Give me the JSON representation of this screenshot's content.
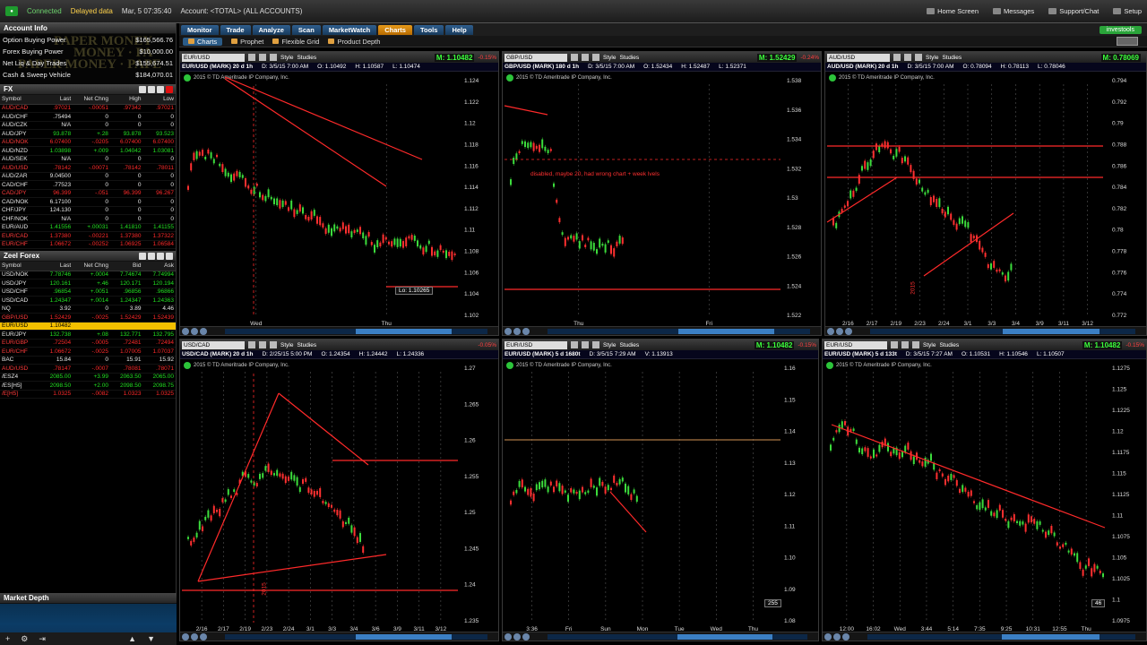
{
  "topbar": {
    "status": "Connected",
    "delay": "Delayed data",
    "datetime": "Mar, 5 07:35:40",
    "account": "Account: <TOTAL> (ALL ACCOUNTS)",
    "links": [
      "Home Screen",
      "Messages",
      "Support/Chat",
      "Setup"
    ]
  },
  "account_info": {
    "title": "Account Info",
    "watermark": [
      "PAPER MONEY",
      "MONEY · PA",
      "PAPER MONEY · PAPE"
    ],
    "rows": [
      {
        "label": "Option Buying Power",
        "value": "$165,566.76"
      },
      {
        "label": "Forex Buying Power",
        "value": "$10,000.00"
      },
      {
        "label": "Net Liq & Day Trades",
        "value": "$155,674.51"
      },
      {
        "label": "Cash & Sweep Vehicle",
        "value": "$184,070.01"
      }
    ]
  },
  "fx_panel": {
    "title": "FX",
    "headers": [
      "Symbol",
      "Last",
      "Net Chng",
      "High",
      "Low"
    ],
    "rows": [
      [
        "AUD/CAD",
        ".97021",
        "-.00051",
        ".97342",
        ".97021",
        "dn"
      ],
      [
        "AUD/CHF",
        ".75494",
        "0",
        "0",
        "0",
        "neu"
      ],
      [
        "AUD/CZK",
        "N/A",
        "0",
        "0",
        "0",
        "neu"
      ],
      [
        "AUD/JPY",
        "93.878",
        "+.28",
        "93.878",
        "93.523",
        "up"
      ],
      [
        "AUD/NOK",
        "6.07400",
        "-.0205",
        "6.07400",
        "6.07400",
        "dn"
      ],
      [
        "AUD/NZD",
        "1.03898",
        "+.009",
        "1.04042",
        "1.03081",
        "up"
      ],
      [
        "AUD/SEK",
        "N/A",
        "0",
        "0",
        "0",
        "neu"
      ],
      [
        "AUD/USD",
        ".78142",
        "-.00071",
        ".78142",
        ".78011",
        "dn"
      ],
      [
        "AUD/ZAR",
        "9.04500",
        "0",
        "0",
        "0",
        "neu"
      ],
      [
        "CAD/CHF",
        ".77523",
        "0",
        "0",
        "0",
        "neu"
      ],
      [
        "CAD/JPY",
        "96.399",
        "-.051",
        "96.399",
        "96.267",
        "dn"
      ],
      [
        "CAD/NOK",
        "6.17100",
        "0",
        "0",
        "0",
        "neu"
      ],
      [
        "CHF/JPY",
        "124.130",
        "0",
        "0",
        "0",
        "neu"
      ],
      [
        "CHF/NOK",
        "N/A",
        "0",
        "0",
        "0",
        "neu"
      ],
      [
        "EUR/AUD",
        "1.41556",
        "+.00031",
        "1.41810",
        "1.41155",
        "up"
      ],
      [
        "EUR/CAD",
        "1.37380",
        "-.00221",
        "1.37380",
        "1.37322",
        "dn"
      ],
      [
        "EUR/CHF",
        "1.06672",
        "-.00252",
        "1.06925",
        "1.06584",
        "dn"
      ]
    ]
  },
  "zeel_panel": {
    "title": "Zeel Forex",
    "headers": [
      "Symbol",
      "Last",
      "Net Chng",
      "Bid",
      "Ask"
    ],
    "rows": [
      [
        "USD/NOK",
        "7.78746",
        "+.0004",
        "7.74674",
        "7.74994",
        "up",
        ""
      ],
      [
        "USD/JPY",
        "120.161",
        "+.46",
        "120.171",
        "120.194",
        "up",
        ""
      ],
      [
        "USD/CHF",
        ".96854",
        "+.0051",
        ".96856",
        ".96866",
        "up",
        ""
      ],
      [
        "USD/CAD",
        "1.24347",
        "+.0014",
        "1.24347",
        "1.24363",
        "up",
        ""
      ],
      [
        "NQ",
        "3.92",
        "0",
        "3.89",
        "4.46",
        "neu",
        ""
      ],
      [
        "GBP/USD",
        "1.52429",
        "-.0025",
        "1.52429",
        "1.52439",
        "dn",
        ""
      ],
      [
        "EUR/USD",
        "1.10482",
        "",
        "",
        "",
        "neu",
        "hl"
      ],
      [
        "EUR/JPY",
        "132.738",
        "+.08",
        "132.771",
        "132.795",
        "up",
        ""
      ],
      [
        "EUR/GBP",
        ".72504",
        "-.0005",
        ".72481",
        ".72494",
        "dn",
        ""
      ],
      [
        "EUR/CHF",
        "1.06672",
        "-.0025",
        "1.07005",
        "1.07037",
        "dn",
        ""
      ],
      [
        "BAC",
        "15.84",
        "0",
        "15.91",
        "15.92",
        "neu",
        ""
      ],
      [
        "AUD/USD",
        ".78147",
        "-.0007",
        ".78081",
        ".78071",
        "dn",
        ""
      ],
      [
        "/ESZ4",
        "2085.00",
        "+3.99",
        "2063.50",
        "2065.00",
        "up",
        ""
      ],
      [
        "/ES[H5]",
        "2098.50",
        "+2.00",
        "2098.50",
        "2098.75",
        "up",
        ""
      ],
      [
        "/E[H5]",
        "1.0325",
        "-.0082",
        "1.0323",
        "1.0325",
        "dn",
        ""
      ]
    ]
  },
  "market_depth": {
    "title": "Market Depth"
  },
  "menu": {
    "tabs": [
      "Monitor",
      "Trade",
      "Analyze",
      "Scan",
      "MarketWatch",
      "Charts",
      "Tools",
      "Help"
    ],
    "active": "Charts",
    "investools": "investools",
    "subtabs": [
      "Charts",
      "Prophet",
      "Flexible Grid",
      "Product Depth"
    ]
  },
  "charts": [
    {
      "symbol": "EUR/USD",
      "title": "EUR/USD (MARK) 20 d 1h",
      "dt": "D: 3/5/15 7:00 AM",
      "o": "O: 1.10492",
      "h": "H: 1.10587",
      "l": "L: 1.10474",
      "last": "M: 1.10482",
      "pct": "-0.15%",
      "copyright": "2015 © TD Ameritrade IP Company, Inc.",
      "yticks": [
        "1.124",
        "1.122",
        "1.12",
        "1.118",
        "1.116",
        "1.114",
        "1.112",
        "1.11",
        "1.108",
        "1.106",
        "1.104",
        "1.102"
      ],
      "xticks": [
        "Wed",
        "Thu"
      ],
      "annot": "Lo: 1.10265"
    },
    {
      "symbol": "GBP/USD",
      "title": "GBP/USD (MARK) 180 d 1h",
      "dt": "D: 3/5/15 7:00 AM",
      "o": "O: 1.52434",
      "h": "H: 1.52487",
      "l": "L: 1.52371",
      "last": "M: 1.52429",
      "pct": "-0.24%",
      "copyright": "2015 © TD Ameritrade IP Company, Inc.",
      "yticks": [
        "1.538",
        "1.536",
        "1.534",
        "1.532",
        "1.53",
        "1.528",
        "1.526",
        "1.524",
        "1.522"
      ],
      "xticks": [
        "Thu",
        "Fri"
      ],
      "annot": "disabled, maybe 20, had wrong chart + week lvels"
    },
    {
      "symbol": "AUD/USD",
      "title": "AUD/USD (MARK) 20 d 1h",
      "dt": "D: 3/5/15 7:00 AM",
      "o": "O: 0.78094",
      "h": "H: 0.78113",
      "l": "L: 0.78046",
      "last": "M: 0.78069",
      "pct": "",
      "copyright": "2015 © TD Ameritrade IP Company, Inc.",
      "yticks": [
        "0.794",
        "0.792",
        "0.79",
        "0.788",
        "0.786",
        "0.784",
        "0.782",
        "0.78",
        "0.778",
        "0.776",
        "0.774",
        "0.772"
      ],
      "xticks": [
        "2/16",
        "2/17",
        "2/19",
        "2/23",
        "2/24",
        "3/1",
        "3/3",
        "3/4",
        "3/9",
        "3/11",
        "3/12"
      ],
      "annot": "2015"
    },
    {
      "symbol": "USD/CAD",
      "title": "USD/CAD (MARK) 20 d 1h",
      "dt": "D: 2/25/15 5:00 PM",
      "o": "O: 1.24354",
      "h": "H: 1.24442",
      "l": "L: 1.24336",
      "last": "",
      "pct": "-0.05%",
      "copyright": "2015 © TD Ameritrade IP Company, Inc.",
      "yticks": [
        "1.27",
        "1.265",
        "1.26",
        "1.255",
        "1.25",
        "1.245",
        "1.24",
        "1.235"
      ],
      "xticks": [
        "2/16",
        "2/17",
        "2/19",
        "2/23",
        "2/24",
        "3/1",
        "3/3",
        "3/4",
        "3/6",
        "3/9",
        "3/11",
        "3/12"
      ],
      "annot": "2015"
    },
    {
      "symbol": "EUR/USD",
      "title": "EUR/USD (MARK) 5 d 1680t",
      "dt": "D: 3/5/15 7:29 AM",
      "o": "V: 1.13913",
      "h": "",
      "l": "",
      "last": "M: 1.10482",
      "pct": "-0.15%",
      "copyright": "2015 © TD Ameritrade IP Company, Inc.",
      "yticks": [
        "1.16",
        "1.15",
        "1.14",
        "1.13",
        "1.12",
        "1.11",
        "1.10",
        "1.09",
        "1.08"
      ],
      "xticks": [
        "3:36",
        "Fri",
        "Sun",
        "Mon",
        "Tue",
        "Wed",
        "Thu"
      ],
      "annot": "255"
    },
    {
      "symbol": "EUR/USD",
      "title": "EUR/USD (MARK) 5 d 133t",
      "dt": "D: 3/5/15 7:27 AM",
      "o": "O: 1.10531",
      "h": "H: 1.10546",
      "l": "L: 1.10507",
      "last": "M: 1.10482",
      "pct": "-0.15%",
      "copyright": "2015 © TD Ameritrade IP Company, Inc.",
      "yticks": [
        "1.1275",
        "1.125",
        "1.1225",
        "1.12",
        "1.1175",
        "1.115",
        "1.1125",
        "1.11",
        "1.1075",
        "1.105",
        "1.1025",
        "1.1",
        "1.0975"
      ],
      "xticks": [
        "12:00",
        "16:02",
        "Wed",
        "3:44",
        "5:14",
        "7:35",
        "9:25",
        "10:31",
        "12:55",
        "Thu"
      ],
      "annot": "46"
    }
  ],
  "toolbar": {
    "style": "Style",
    "studies": "Studies"
  }
}
